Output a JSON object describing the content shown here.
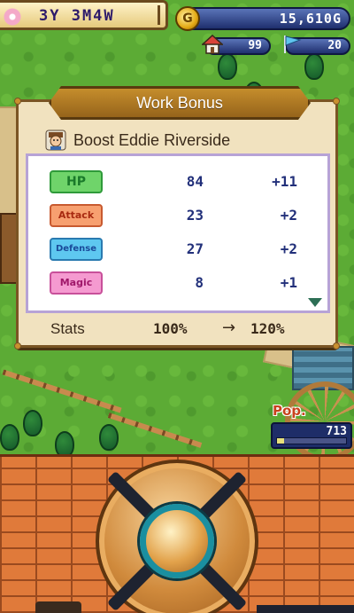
{
  "hud": {
    "date": "3Y 3M4W",
    "gold": "15,610G",
    "coin_symbol": "G",
    "houses": "99",
    "flags": "20"
  },
  "dialog": {
    "title": "Work Bonus",
    "subject": "Boost Eddie Riverside",
    "stats": [
      {
        "label": "HP",
        "value": "84",
        "bonus": "+11",
        "badge_color": "#6fd46a",
        "badge_text_color": "#1a7a2a"
      },
      {
        "label": "Attack",
        "value": "23",
        "bonus": "+2",
        "badge_color": "#f7a070",
        "badge_text_color": "#a82a10"
      },
      {
        "label": "Defense",
        "value": "27",
        "bonus": "+2",
        "badge_color": "#5ec8f0",
        "badge_text_color": "#1a4a9a"
      },
      {
        "label": "Magic",
        "value": "8",
        "bonus": "+1",
        "badge_color": "#f59ad0",
        "badge_text_color": "#a0186a"
      }
    ],
    "footer": {
      "label": "Stats",
      "from": "100%",
      "arrow": "→",
      "to": "120%"
    }
  },
  "population": {
    "label": "Pop.",
    "value": "713",
    "fill_fraction": 0.1
  },
  "icons": {
    "coin": "gold-coin-icon",
    "house": "house-icon",
    "flag": "flag-icon",
    "face": "character-face-icon",
    "scroll": "scroll-down-arrow-icon"
  }
}
